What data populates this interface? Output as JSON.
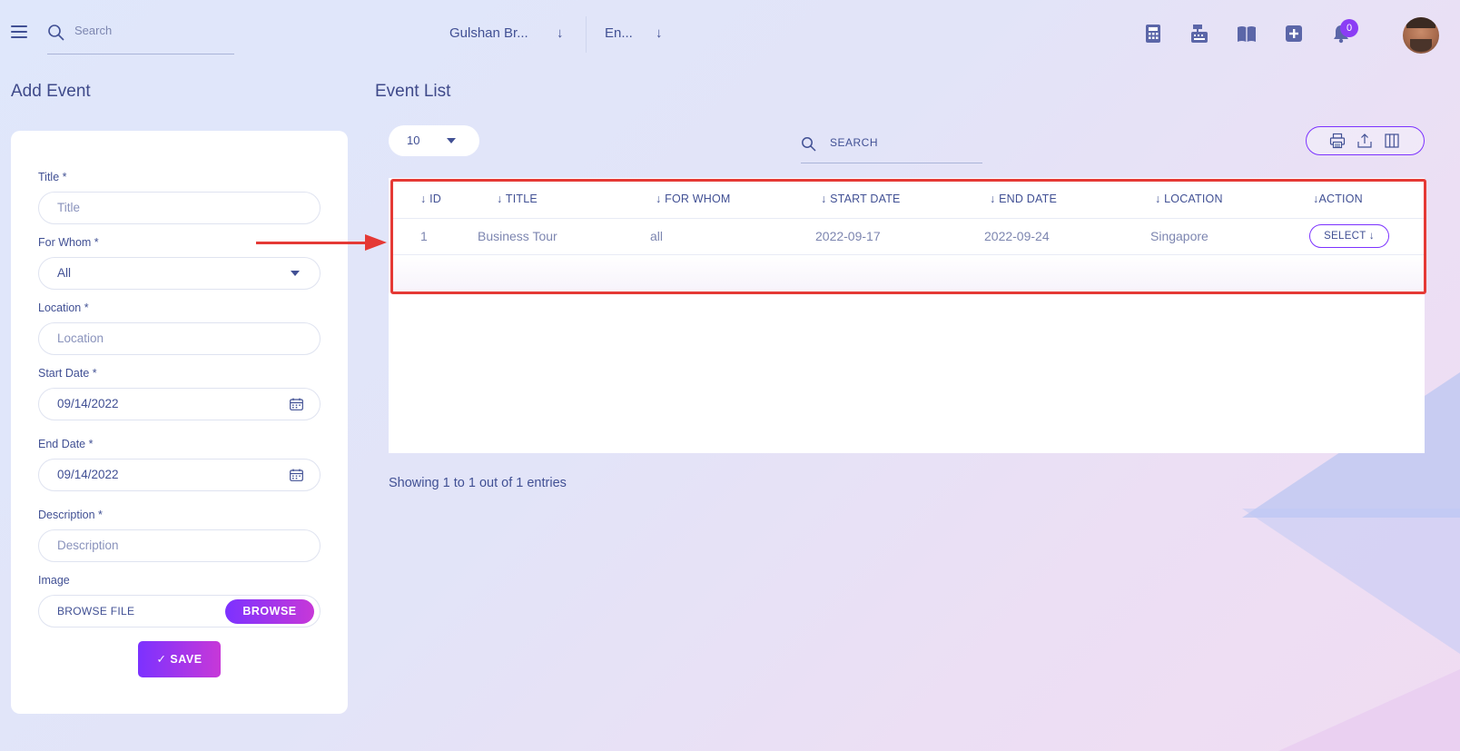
{
  "header": {
    "search_placeholder": "Search",
    "school_name": "Gulshan Br...",
    "language": "En...",
    "notification_count": "0"
  },
  "add_event": {
    "title": "Add Event",
    "fields": {
      "title_label": "Title *",
      "title_placeholder": "Title",
      "for_whom_label": "For Whom *",
      "for_whom_value": "All",
      "location_label": "Location *",
      "location_placeholder": "Location",
      "start_date_label": "Start Date *",
      "start_date_value": "09/14/2022",
      "end_date_label": "End Date *",
      "end_date_value": "09/14/2022",
      "description_label": "Description *",
      "description_placeholder": "Description",
      "image_label": "Image",
      "browse_file_text": "BROWSE FILE",
      "browse_button": "BROWSE"
    },
    "save_button": "✓ SAVE"
  },
  "event_list": {
    "title": "Event List",
    "page_size": "10",
    "search_placeholder": "SEARCH",
    "columns": [
      "↓ ID",
      "↓ TITLE",
      "↓ FOR WHOM",
      "↓ START DATE",
      "↓ END DATE",
      "↓ LOCATION",
      "↓ACTION"
    ],
    "rows": [
      {
        "id": "1",
        "title": "Business Tour",
        "for_whom": "all",
        "start_date": "2022-09-17",
        "end_date": "2022-09-24",
        "location": "Singapore",
        "action": "SELECT ↓"
      }
    ],
    "showing": "Showing 1 to 1 out of 1 entries"
  },
  "colors": {
    "accent": "#7c32ff",
    "accent_gradient_end": "#c738d8",
    "text": "#415094",
    "highlight": "#e53935"
  },
  "icons": [
    "menu-icon",
    "search-icon",
    "chevron-down-icon",
    "calculator-icon",
    "cash-register-icon",
    "book-icon",
    "plus-square-icon",
    "bell-icon",
    "calendar-icon",
    "print-icon",
    "export-icon",
    "columns-icon"
  ]
}
